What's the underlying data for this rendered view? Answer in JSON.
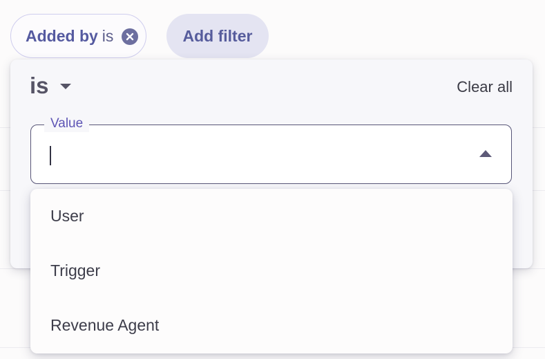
{
  "filter_bar": {
    "active_chip": {
      "field": "Added by",
      "operator": "is",
      "remove_icon": "close-circle-icon"
    },
    "add_filter_label": "Add filter"
  },
  "popover": {
    "operator": {
      "label": "is",
      "icon": "caret-down-icon"
    },
    "clear_all_label": "Clear all",
    "value_field": {
      "label": "Value",
      "value": "",
      "toggle_icon": "caret-up-icon",
      "expanded": true
    }
  },
  "options": [
    "User",
    "Trigger",
    "Revenue Agent"
  ],
  "colors": {
    "accent": "#5e55b5",
    "chip_text": "#555aa0",
    "add_chip_bg": "#e4e4f2",
    "remove_icon_bg": "#6d6f9f"
  }
}
